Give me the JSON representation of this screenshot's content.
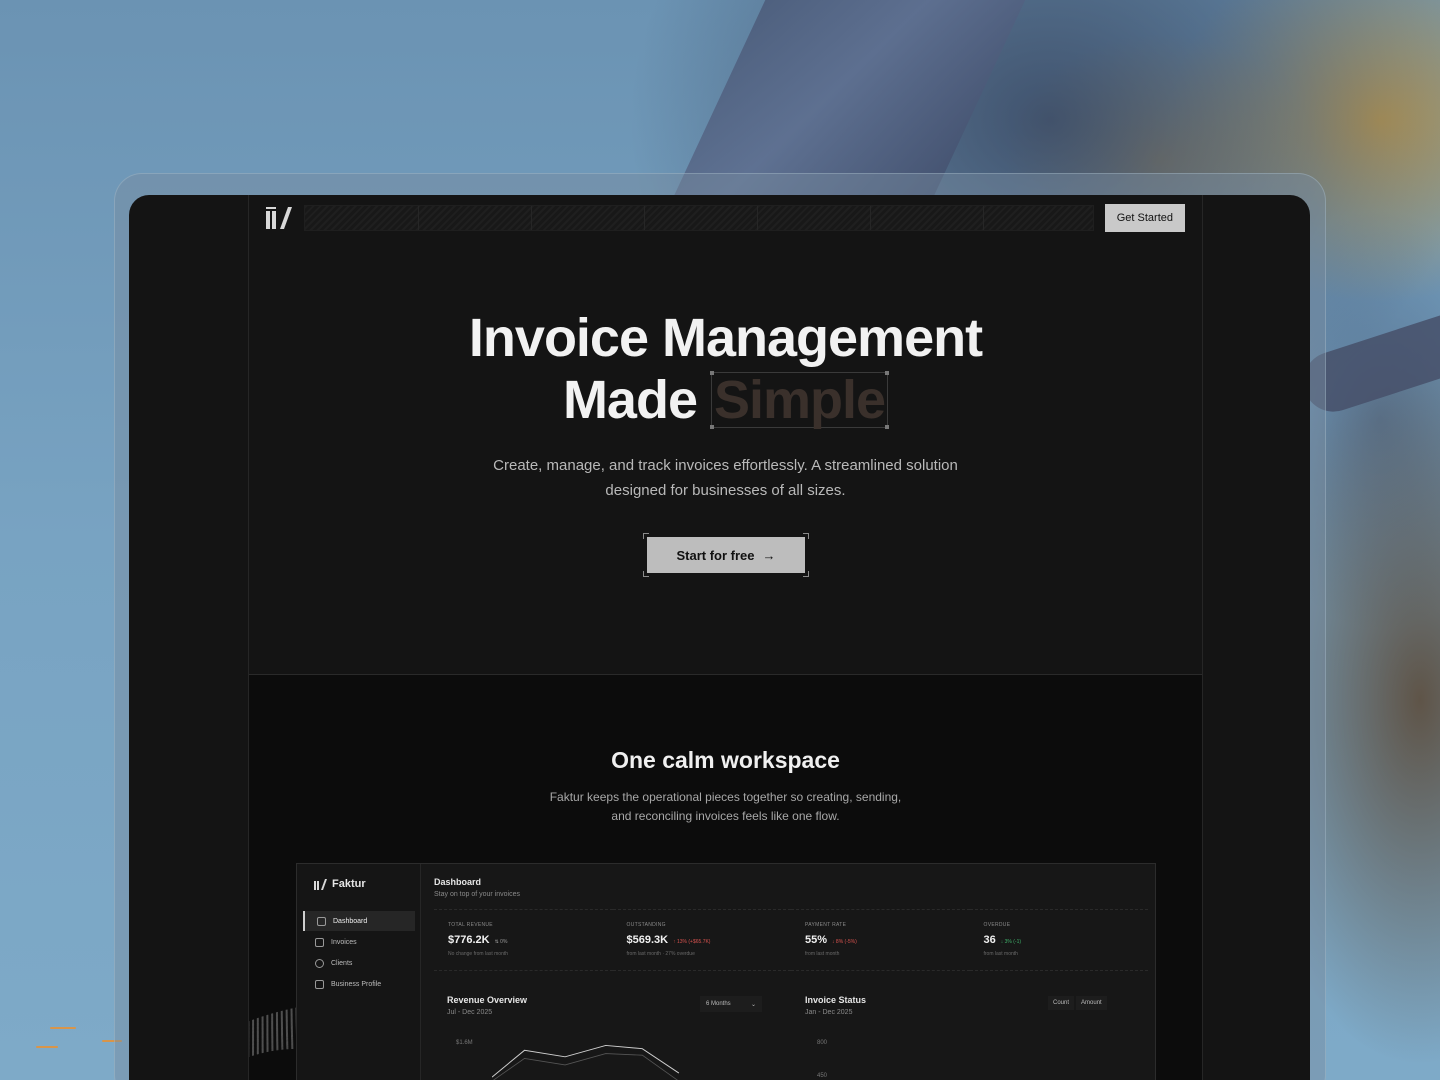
{
  "nav": {
    "cta_label": "Get Started"
  },
  "hero": {
    "title_line1": "Invoice Management",
    "title_line2_prefix": "Made",
    "title_highlight": "Simple",
    "subtitle_line1": "Create, manage, and track invoices effortlessly. A streamlined solution",
    "subtitle_line2": "designed for businesses of all sizes.",
    "cta_label": "Start for free",
    "cta_arrow": "→"
  },
  "showcase": {
    "title": "One calm workspace",
    "subtitle_line1": "Faktur keeps the operational pieces together so creating, sending,",
    "subtitle_line2": "and reconciling invoices feels like one flow."
  },
  "app": {
    "brand": "Faktur",
    "sidebar": [
      {
        "label": "Dashboard",
        "icon": "grid-icon",
        "active": true
      },
      {
        "label": "Invoices",
        "icon": "file-icon",
        "active": false
      },
      {
        "label": "Clients",
        "icon": "users-icon",
        "active": false
      },
      {
        "label": "Business Profile",
        "icon": "building-icon",
        "active": false
      }
    ],
    "dashboard_title": "Dashboard",
    "dashboard_subtitle": "Stay on top of your invoices",
    "stats": [
      {
        "label": "TOTAL REVENUE",
        "value": "$776.2K",
        "delta": "⇅ 0%",
        "delta_color": "#9a9a9a",
        "note": "No change from last month"
      },
      {
        "label": "OUTSTANDING",
        "value": "$569.3K",
        "delta": "↑ 13% (+$65.7K)",
        "delta_color": "#d9534f",
        "note": "from last month · 27% overdue"
      },
      {
        "label": "PAYMENT RATE",
        "value": "55%",
        "delta": "↓ 8% (-5%)",
        "delta_color": "#d9534f",
        "note": "from last month"
      },
      {
        "label": "OVERDUE",
        "value": "36",
        "delta": "↓ 3% (-1)",
        "delta_color": "#3fb26b",
        "note": "from last month"
      }
    ],
    "revenue_card": {
      "title": "Revenue Overview",
      "range": "Jul - Dec 2025",
      "select_value": "6 Months",
      "y_tick": "$1.6M"
    },
    "status_card": {
      "title": "Invoice Status",
      "range": "Jan - Dec 2025",
      "toggle": [
        "Count",
        "Amount"
      ],
      "y_ticks": [
        "800",
        "450"
      ]
    }
  },
  "colors": {
    "accent_light": "#c9c9c9",
    "background": "#141414",
    "negative": "#d9534f",
    "positive": "#3fb26b"
  }
}
